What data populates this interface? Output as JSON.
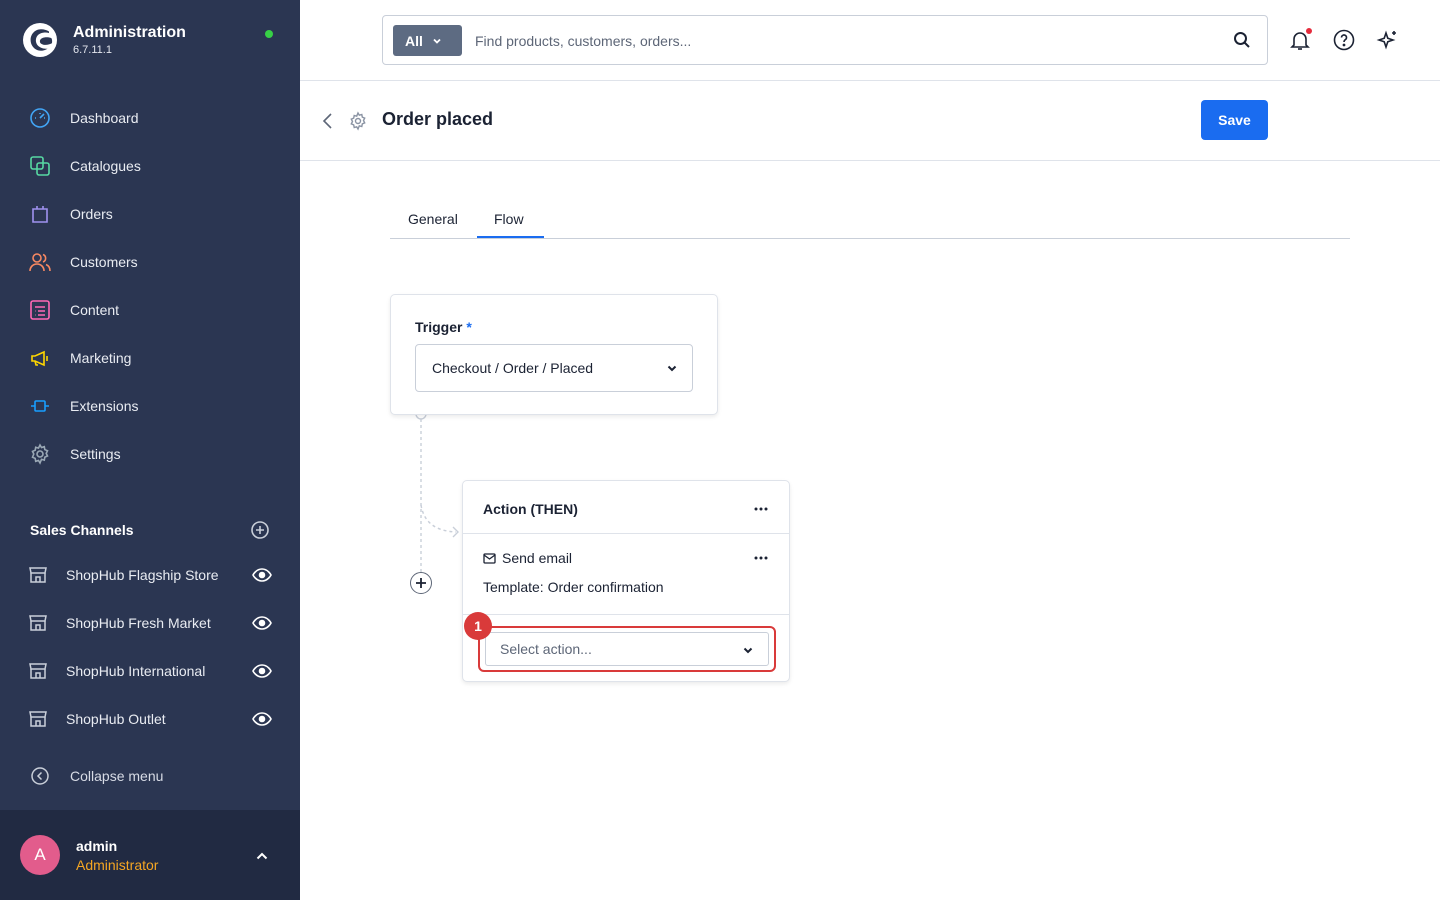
{
  "app": {
    "title": "Administration",
    "version": "6.7.11.1"
  },
  "sidebar": {
    "items": [
      {
        "label": "Dashboard",
        "icon": "dashboard-icon",
        "color": "#42a5f5"
      },
      {
        "label": "Catalogues",
        "icon": "catalogue-icon",
        "color": "#57d9a3"
      },
      {
        "label": "Orders",
        "icon": "orders-icon",
        "color": "#a092f0"
      },
      {
        "label": "Customers",
        "icon": "customers-icon",
        "color": "#f88962"
      },
      {
        "label": "Content",
        "icon": "content-icon",
        "color": "#ff68b4"
      },
      {
        "label": "Marketing",
        "icon": "marketing-icon",
        "color": "#ffd700"
      },
      {
        "label": "Extensions",
        "icon": "extensions-icon",
        "color": "#189eff"
      },
      {
        "label": "Settings",
        "icon": "settings-icon",
        "color": "#9aa8b5"
      }
    ],
    "sales_channels_title": "Sales Channels",
    "sales_channels": [
      {
        "label": "ShopHub Flagship Store"
      },
      {
        "label": "ShopHub Fresh Market"
      },
      {
        "label": "ShopHub International"
      },
      {
        "label": "ShopHub Outlet"
      }
    ],
    "collapse_label": "Collapse menu"
  },
  "user": {
    "initial": "A",
    "name": "admin",
    "role": "Administrator"
  },
  "search": {
    "filter_label": "All",
    "placeholder": "Find products, customers, orders..."
  },
  "page": {
    "title": "Order placed",
    "save_label": "Save"
  },
  "tabs": [
    {
      "label": "General"
    },
    {
      "label": "Flow",
      "active": true
    }
  ],
  "flow": {
    "trigger_label": "Trigger",
    "required_marker": "*",
    "trigger_value": "Checkout / Order / Placed",
    "action_title": "Action (THEN)",
    "action_name": "Send email",
    "action_detail": "Template: Order confirmation",
    "select_action_placeholder": "Select action...",
    "step_badge": "1"
  },
  "colors": {
    "sidebar_bg": "#2b3652",
    "accent": "#1a6cf0",
    "highlight": "#d93a3a",
    "status_online": "#37d046"
  }
}
